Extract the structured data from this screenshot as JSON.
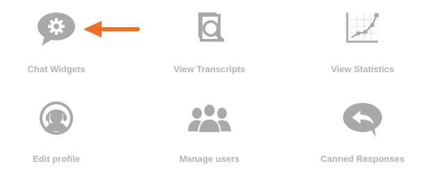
{
  "tiles": [
    {
      "id": "chat-widgets",
      "label": "Chat Widgets",
      "icon": "chat-gear-icon"
    },
    {
      "id": "view-transcripts",
      "label": "View Transcripts",
      "icon": "document-search-icon"
    },
    {
      "id": "view-statistics",
      "label": "View Statistics",
      "icon": "line-graph-icon"
    },
    {
      "id": "edit-profile",
      "label": "Edit profile",
      "icon": "headset-user-icon"
    },
    {
      "id": "manage-users",
      "label": "Manage users",
      "icon": "users-group-icon"
    },
    {
      "id": "canned-responses",
      "label": "Canned Responses",
      "icon": "reply-bubble-icon"
    }
  ],
  "annotation": {
    "icon": "arrow-left-icon",
    "color": "#f26f21"
  },
  "colors": {
    "icon_gray": "#a7a9ab",
    "label_gray": "#b3b3b3"
  }
}
